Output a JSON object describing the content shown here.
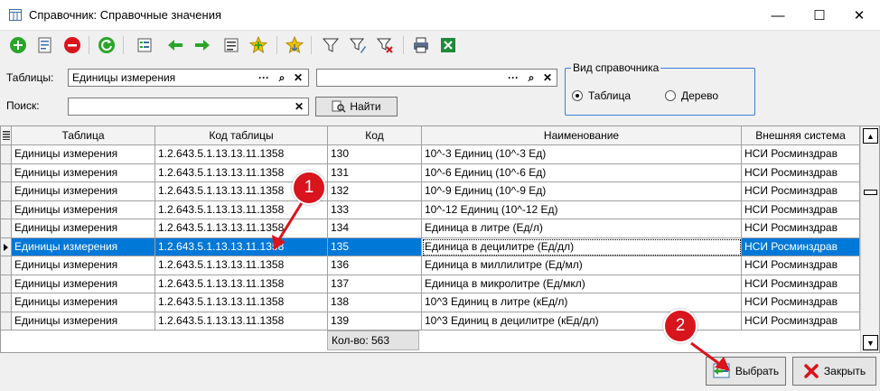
{
  "window": {
    "title": "Справочник: Справочные значения",
    "min": "—",
    "max": "☐",
    "close": "✕"
  },
  "filters": {
    "tables_label": "Таблицы:",
    "tables_value": "Единицы измерения",
    "tables_value2": "",
    "search_label": "Поиск:",
    "search_value": "",
    "find_button": "Найти",
    "ellipsis": "···",
    "search_glyph": "⌕",
    "clear_glyph": "✕"
  },
  "view_group": {
    "title": "Вид справочника",
    "options": [
      "Таблица",
      "Дерево"
    ],
    "selected": "Таблица"
  },
  "grid": {
    "columns": [
      "Таблица",
      "Код таблицы",
      "Код",
      "Наименование",
      "Внешняя система"
    ],
    "rows": [
      [
        "Единицы измерения",
        "1.2.643.5.1.13.13.11.1358",
        "130",
        "10^-3 Единиц (10^-3 Ед)",
        "НСИ Росминздрав"
      ],
      [
        "Единицы измерения",
        "1.2.643.5.1.13.13.11.1358",
        "131",
        "10^-6 Единиц (10^-6 Ед)",
        "НСИ Росминздрав"
      ],
      [
        "Единицы измерения",
        "1.2.643.5.1.13.13.11.1358",
        "132",
        "10^-9 Единиц (10^-9 Ед)",
        "НСИ Росминздрав"
      ],
      [
        "Единицы измерения",
        "1.2.643.5.1.13.13.11.1358",
        "133",
        "10^-12 Единиц (10^-12 Ед)",
        "НСИ Росминздрав"
      ],
      [
        "Единицы измерения",
        "1.2.643.5.1.13.13.11.1358",
        "134",
        "Единица в литре (Ед/л)",
        "НСИ Росминздрав"
      ],
      [
        "Единицы измерения",
        "1.2.643.5.1.13.13.11.1358",
        "135",
        "Единица в децилитре (Ед/дл)",
        "НСИ Росминздрав"
      ],
      [
        "Единицы измерения",
        "1.2.643.5.1.13.13.11.1358",
        "136",
        "Единица в миллилитре (Ед/мл)",
        "НСИ Росминздрав"
      ],
      [
        "Единицы измерения",
        "1.2.643.5.1.13.13.11.1358",
        "137",
        "Единица в микролитре (Ед/мкл)",
        "НСИ Росминздрав"
      ],
      [
        "Единицы измерения",
        "1.2.643.5.1.13.13.11.1358",
        "138",
        "10^3 Единиц в литре (кЕд/л)",
        "НСИ Росминздрав"
      ],
      [
        "Единицы измерения",
        "1.2.643.5.1.13.13.11.1358",
        "139",
        "10^3 Единиц в децилитре (кЕд/дл)",
        "НСИ Росминздрав"
      ]
    ],
    "selected_index": 5,
    "count_label": "Кол-во: 563"
  },
  "buttons": {
    "select": "Выбрать",
    "close": "Закрыть"
  },
  "annotations": {
    "badge1": "1",
    "badge2": "2"
  },
  "colors": {
    "selection": "#0078d7",
    "badge": "#d8141c",
    "accent_green": "#2aa52a",
    "accent_red": "#d8141c"
  },
  "icons": [
    "add-icon",
    "edit-record-icon",
    "delete-icon",
    "refresh-icon",
    "properties-icon",
    "arrow-left-icon",
    "arrow-right-icon",
    "list-icon",
    "add-child-icon",
    "favorites-icon",
    "filter-icon",
    "filter-edit-icon",
    "filter-clear-icon",
    "print-icon",
    "excel-icon"
  ]
}
